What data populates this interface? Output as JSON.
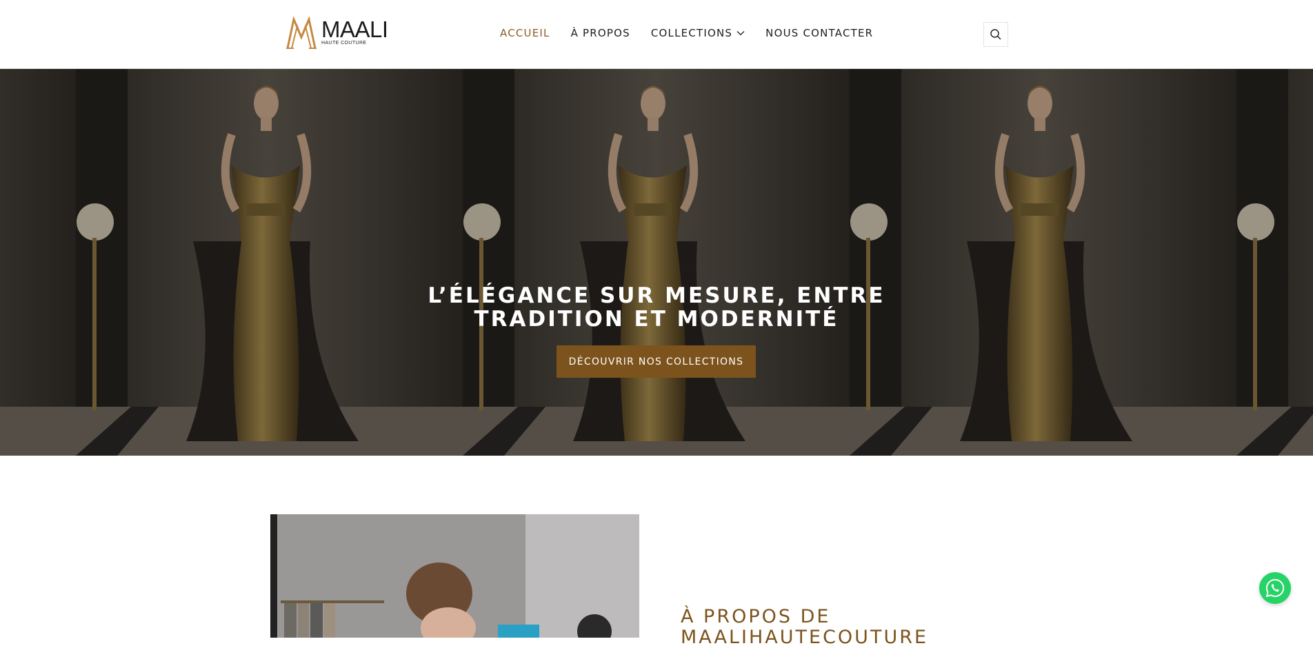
{
  "brand": {
    "name": "MAALI",
    "tagline": "HAUTE COUTURE",
    "accent_color": "#7c531c",
    "active_nav_color": "#8a5e22"
  },
  "nav": {
    "items": [
      {
        "label": "ACCUEIL",
        "active": true
      },
      {
        "label": "À PROPOS",
        "active": false
      },
      {
        "label": "COLLECTIONS",
        "active": false,
        "has_dropdown": true
      },
      {
        "label": "NOUS CONTACTER",
        "active": false
      }
    ],
    "search_icon": "search-icon"
  },
  "hero": {
    "title_line1": "L’ÉLÉGANCE SUR MESURE, ENTRE",
    "title_line2": "TRADITION ET MODERNITÉ",
    "button_label": "DÉCOUVRIR NOS COLLECTIONS"
  },
  "about": {
    "heading_line1": "À PROPOS DE",
    "heading_line2": "MAALIHAUTECOUTURE"
  },
  "floating": {
    "whatsapp_icon": "whatsapp-icon",
    "whatsapp_color": "#25d366"
  }
}
